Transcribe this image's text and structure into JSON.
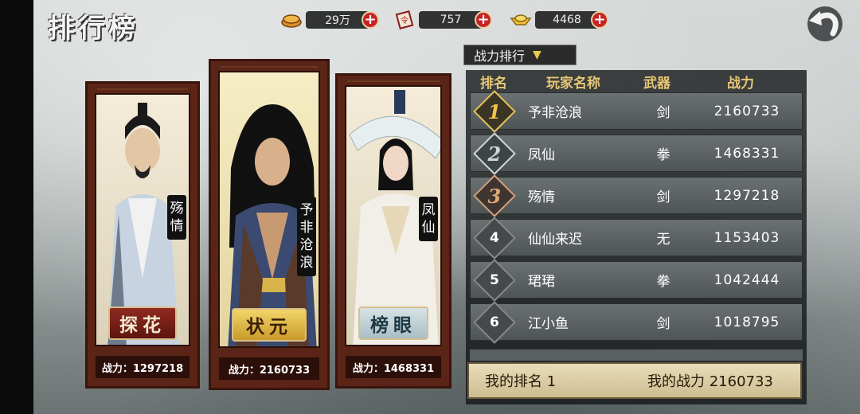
{
  "header": {
    "title": "排行榜",
    "resources": [
      {
        "icon": "coin-icon",
        "value": "29万"
      },
      {
        "icon": "token-icon",
        "value": "757"
      },
      {
        "icon": "gold-ingot-icon",
        "value": "4468"
      }
    ]
  },
  "podium": [
    {
      "place": 3,
      "title_badge": "探花",
      "name_vertical": "殇情",
      "power_label": "战力：1297218"
    },
    {
      "place": 1,
      "title_badge": "状元",
      "name_vertical": "予非沧浪",
      "power_label": "战力：2160733"
    },
    {
      "place": 2,
      "title_badge": "榜眼",
      "name_vertical": "凤仙",
      "power_label": "战力：1468331"
    }
  ],
  "ranking": {
    "dropdown_label": "战力排行",
    "columns": [
      "排名",
      "玩家名称",
      "武器",
      "战力"
    ],
    "rows": [
      {
        "rank": "1",
        "name": "予非沧浪",
        "weapon": "剑",
        "power": "2160733"
      },
      {
        "rank": "2",
        "name": "凤仙",
        "weapon": "拳",
        "power": "1468331"
      },
      {
        "rank": "3",
        "name": "殇情",
        "weapon": "剑",
        "power": "1297218"
      },
      {
        "rank": "4",
        "name": "仙仙来迟",
        "weapon": "无",
        "power": "1153403"
      },
      {
        "rank": "5",
        "name": "珺珺",
        "weapon": "拳",
        "power": "1042444"
      },
      {
        "rank": "6",
        "name": "江小鱼",
        "weapon": "剑",
        "power": "1018795"
      }
    ],
    "my_rank_label": "我的排名 1",
    "my_power_label": "我的战力 2160733"
  },
  "colors": {
    "gold": "#e5c35a",
    "plus_red": "#c62424",
    "panel_bg": "#2b2e30"
  }
}
